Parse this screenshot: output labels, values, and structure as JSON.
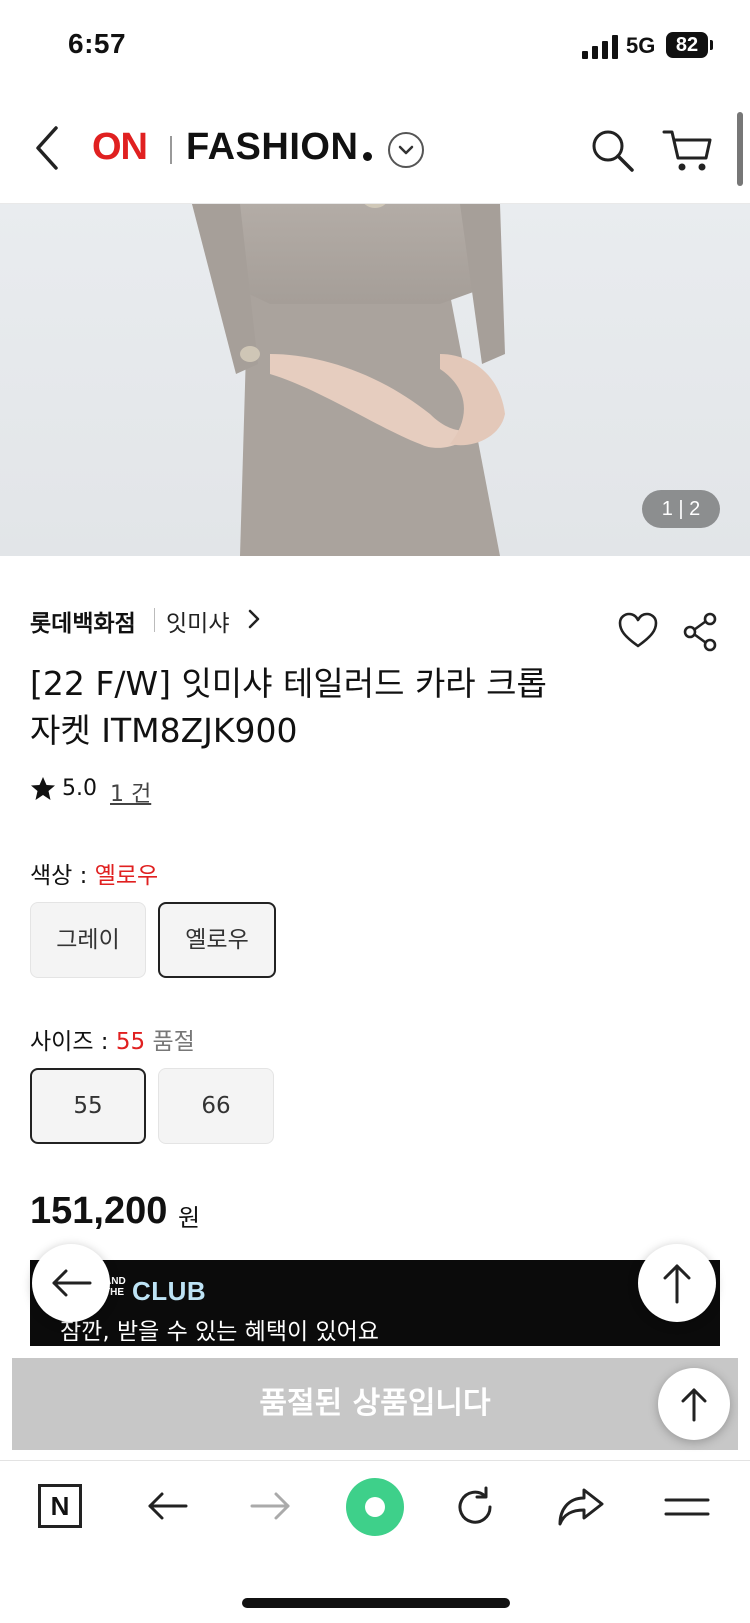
{
  "status_bar": {
    "time": "6:57",
    "network": "5G",
    "battery": "82"
  },
  "header": {
    "logo_on": "ON",
    "logo_fashion": "FASHION"
  },
  "gallery": {
    "pager": "1 | 2"
  },
  "product": {
    "store": "롯데백화점",
    "brand": "잇미샤",
    "title_line1": "[22 F/W] 잇미샤 테일러드 카라 크롭",
    "title_line2": "자켓 ITM8ZJK900",
    "rating": "5.0",
    "review_count": "1 건",
    "color_label": "색상 : ",
    "color_selected": "옐로우",
    "colors": [
      "그레이",
      "옐로우"
    ],
    "size_label": "사이즈 : ",
    "size_selected": "55",
    "size_status": " 품절",
    "sizes": [
      "55",
      "66"
    ],
    "price": "151,200",
    "price_unit": "원"
  },
  "club_banner": {
    "logo_small": "AND THE",
    "logo": "CLUB",
    "text": "잠깐, 받을 수 있는 혜택이 있어요"
  },
  "soldout_button": "품절된 상품입니다",
  "toolbar": {
    "n_label": "N"
  },
  "colors": {
    "accent_red": "#e02020",
    "home_green": "#3ed08a",
    "soldout_gray": "#c7c7c7"
  }
}
